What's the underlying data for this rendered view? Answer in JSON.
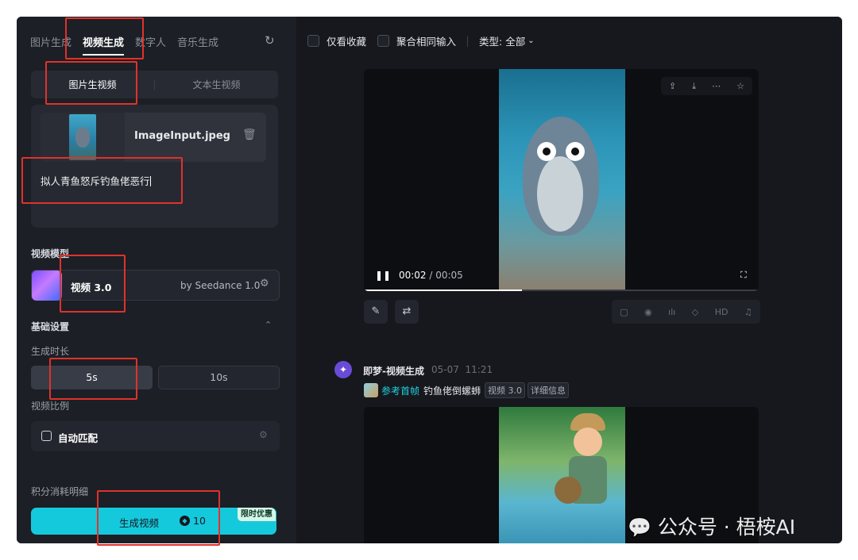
{
  "left_panel": {
    "tabs": [
      {
        "label": "图片生成",
        "active": false
      },
      {
        "label": "视频生成",
        "active": true
      },
      {
        "label": "数字人",
        "active": false
      },
      {
        "label": "音乐生成",
        "active": false
      }
    ],
    "mode_tabs": [
      {
        "label": "图片生视频",
        "active": true
      },
      {
        "label": "文本生视频",
        "active": false
      }
    ],
    "upload": {
      "file_name": "ImageInput.jpeg",
      "prompt": "拟人青鱼怒斥钓鱼佬恶行"
    },
    "model_section_label": "视频模型",
    "model": {
      "name": "视频 3.0",
      "provider": "by Seedance 1.0"
    },
    "basic_settings_label": "基础设置",
    "duration_label": "生成时长",
    "durations": [
      {
        "label": "5s",
        "selected": true
      },
      {
        "label": "10s",
        "selected": false
      }
    ],
    "ratio_label": "视频比例",
    "ratio_value": "自动匹配",
    "cost_label": "积分消耗明细",
    "generate": {
      "label": "生成视频",
      "cost": "10",
      "promo": "限时优惠"
    }
  },
  "right_panel": {
    "filters": {
      "favorites_only": "仅看收藏",
      "merge_same_input": "聚合相同输入",
      "type_filter": "类型: 全部"
    },
    "video1": {
      "current_time": "00:02",
      "separator": "/",
      "duration": "00:05",
      "progress": 0.4,
      "quality_label": "HD"
    },
    "record2": {
      "author": "即梦-视频生成",
      "date": "05-07",
      "time": "11:21",
      "ref_label": "参考首帧",
      "prompt": "钓鱼佬倒螺蛳",
      "model_tag": "视频 3.0",
      "detail_tag": "详细信息"
    }
  },
  "watermark": "公众号 · 梧桉AI",
  "colors": {
    "accent": "#15c9dd",
    "highlight_box": "#e0322b",
    "panel_bg": "#1c1f26"
  },
  "icons": [
    "refresh-icon",
    "trash-icon",
    "tune-icon",
    "chevron-up-icon",
    "chevron-down-icon",
    "pause-icon",
    "fullscreen-icon",
    "upload-icon",
    "download-icon",
    "more-icon",
    "star-icon",
    "pen-icon",
    "loop-icon",
    "wechat-icon"
  ]
}
